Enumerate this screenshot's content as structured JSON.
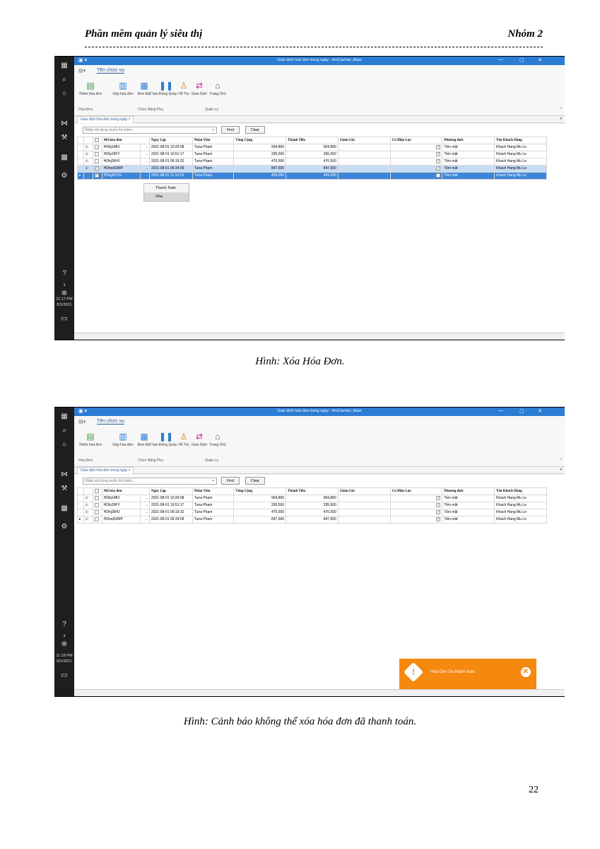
{
  "header": {
    "left": "Phần mềm quản lý siêu thị",
    "right": "Nhóm 2"
  },
  "screens": [
    {
      "window_title": "Giao dịch hóa đơn trong ngày - frmCashier_Main",
      "clock_time": "11:17 PM",
      "clock_date": "8/1/2021",
      "ribbon_tab": "Tên chức vụ",
      "buttons": [
        "Thêm hóa đơn",
        "Gộp hóa đơn",
        "Đơn Đặt",
        "Tạm Đóng Quầy",
        "Hỗ Trợ",
        "Giao Dịch",
        "Trang Chủ"
      ],
      "groups": [
        "Hóa Đơn",
        "Chức Năng Phụ",
        "Quản Lý"
      ],
      "doc_tab": "Giao dịch hóa đơn trong ngày",
      "search_placeholder": "Nhập nội dung muốn tìm kiếm...",
      "find": "Find",
      "clear": "Clear",
      "columns": [
        "Mã hóa đơn",
        "Ngày Lập",
        "Nhân Viên",
        "Tổng Cộng",
        "Thành Tiền",
        "Giảm Giá",
        "Có Hiệu Lực",
        "Phương thức",
        "Tên Khách Hàng"
      ],
      "rows": [
        {
          "checked": false,
          "id": "HDbj14BJ",
          "date": "2021-08-01 10:20:08",
          "staff": "Tuna Phạm",
          "total": "904,800",
          "net": "904,800",
          "discount": "",
          "valid": true,
          "method": "Tiền mặt",
          "customer": "Khach Hang Mu Le"
        },
        {
          "checked": false,
          "id": "HDfy29FY",
          "date": "2021-08-01 10:51:17",
          "staff": "Tuna Phạm",
          "total": "295,500",
          "net": "295,500",
          "discount": "",
          "valid": true,
          "method": "Tiền mặt",
          "customer": "Khach Hang Mu Le"
        },
        {
          "checked": false,
          "id": "HDhj36HJ",
          "date": "2021-08-01 06:19:32",
          "staff": "Tuna Phạm",
          "total": "470,500",
          "net": "470,500",
          "discount": "",
          "valid": true,
          "method": "Tiền mặt",
          "customer": "Khach Hang Mu Le"
        },
        {
          "checked": true,
          "id": "HDmp52MP",
          "date": "2021-08-01 06:34:09",
          "staff": "Tuna Phạm",
          "total": "847,600",
          "net": "847,600",
          "discount": "",
          "valid": true,
          "method": "Tiền mặt",
          "customer": "Khach Hang Mu Le"
        },
        {
          "checked": true,
          "id": "HDvg87VG",
          "date": "2021-08-01 11:16:53",
          "staff": "Tuna Phạm",
          "total": "459,000",
          "net": "459,000",
          "discount": "",
          "valid": false,
          "method": "Tiền mặt",
          "customer": "Khach Hang Mu Le"
        }
      ],
      "context_menu": [
        "Thanh Toán",
        "Xóa"
      ]
    },
    {
      "window_title": "Giao dịch hóa đơn trong ngày - frmCashier_Main",
      "clock_time": "11:18 PM",
      "clock_date": "8/1/2021",
      "ribbon_tab": "Tên chức vụ",
      "buttons": [
        "Thêm hóa đơn",
        "Gộp hóa đơn",
        "Đơn Đặt",
        "Tạm Đóng Quầy",
        "Hỗ Trợ",
        "Giao Dịch",
        "Trang Chủ"
      ],
      "groups": [
        "Hóa Đơn",
        "Chức Năng Phụ",
        "Quản Lý"
      ],
      "doc_tab": "Giao dịch hóa đơn trong ngày",
      "search_placeholder": "Nhập nội dung muốn tìm kiếm...",
      "find": "Find",
      "clear": "Clear",
      "columns": [
        "Mã hóa đơn",
        "Ngày Lập",
        "Nhân Viên",
        "Tổng Cộng",
        "Thành Tiền",
        "Giảm Giá",
        "Có Hiệu Lực",
        "Phương thức",
        "Tên Khách Hàng"
      ],
      "rows": [
        {
          "checked": false,
          "id": "HDbj14BJ",
          "date": "2021-08-01 10:20:08",
          "staff": "Tuna Phạm",
          "total": "904,800",
          "net": "904,800",
          "discount": "",
          "valid": true,
          "method": "Tiền mặt",
          "customer": "Khach Hang Mu Le"
        },
        {
          "checked": false,
          "id": "HDfy29FY",
          "date": "2021-08-01 10:51:17",
          "staff": "Tuna Phạm",
          "total": "295,500",
          "net": "295,500",
          "discount": "",
          "valid": true,
          "method": "Tiền mặt",
          "customer": "Khach Hang Mu Le"
        },
        {
          "checked": false,
          "id": "HDhj36HJ",
          "date": "2021-08-01 06:19:32",
          "staff": "Tuna Phạm",
          "total": "470,500",
          "net": "470,500",
          "discount": "",
          "valid": true,
          "method": "Tiền mặt",
          "customer": "Khach Hang Mu Le"
        },
        {
          "checked": false,
          "id": "HDmp52MP",
          "date": "2021-08-01 06:34:09",
          "staff": "Tuna Phạm",
          "total": "847,600",
          "net": "847,600",
          "discount": "",
          "valid": true,
          "method": "Tiền mặt",
          "customer": "Khach Hang Mu Le"
        }
      ],
      "toast": "Hoa Don Da thanh toan"
    }
  ],
  "captions": [
    "Hình: Xóa Hóa Đơn.",
    "Hình: Cảnh báo không thể xóa hóa đơn đã thanh toán."
  ],
  "page_number": "22",
  "colors": {
    "titlebar": "#2b7cd3",
    "selected_row": "#3d85d8",
    "toast": "#f5880f"
  }
}
